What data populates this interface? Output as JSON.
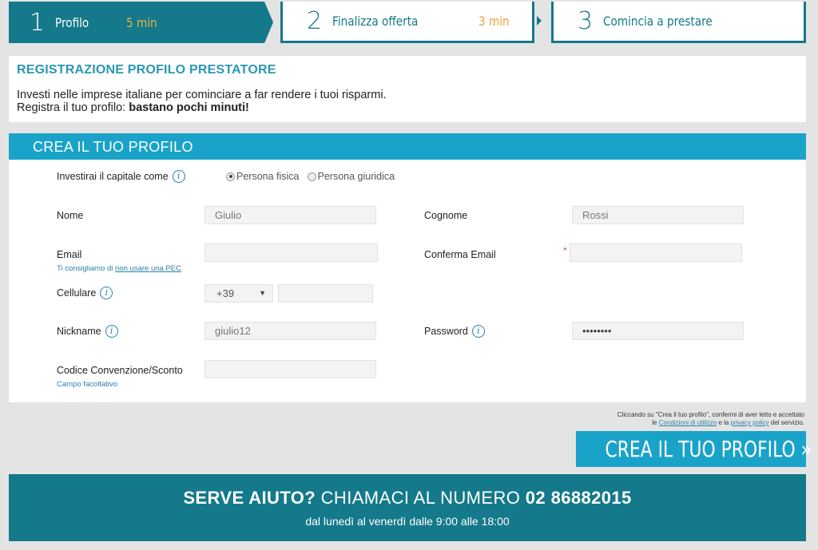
{
  "steps": [
    {
      "num": "1",
      "label": "Profilo",
      "time": "5 min"
    },
    {
      "num": "2",
      "label": "Finalizza offerta",
      "time": "3 min"
    },
    {
      "num": "3",
      "label": "Comincia a prestare",
      "time": ""
    }
  ],
  "intro": {
    "title": "REGISTRAZIONE PROFILO PRESTATORE",
    "line1": "Investi nelle imprese italiane per cominciare a far rendere i tuoi risparmi.",
    "line2_prefix": "Registra il tuo profilo: ",
    "line2_bold": "bastano pochi minuti!"
  },
  "form": {
    "header": "CREA IL TUO PROFILO",
    "invest_label": "Investirai il capitale come",
    "radio_options": [
      {
        "label": "Persona fisica",
        "checked": true
      },
      {
        "label": "Persona giuridica",
        "checked": false
      }
    ],
    "nome": {
      "label": "Nome",
      "value": "Giulio"
    },
    "cognome": {
      "label": "Cognome",
      "value": "Rossi"
    },
    "email": {
      "label": "Email",
      "value": "",
      "hint_prefix": "Ti consigliamo di ",
      "hint_link": "non usare una PEC"
    },
    "conferma_email": {
      "label": "Conferma Email",
      "value": "",
      "required_mark": "*"
    },
    "cellulare": {
      "label": "Cellulare",
      "prefix": "+39",
      "value": ""
    },
    "nickname": {
      "label": "Nickname",
      "value": "giulio12"
    },
    "password": {
      "label": "Password",
      "value": "••••••••"
    },
    "codice": {
      "label": "Codice Convenzione/Sconto",
      "value": "",
      "hint": "Campo facoltativo"
    }
  },
  "terms": {
    "line1": "Cliccando su \"Crea il tuo profilo\", confermi di aver letto e accettato",
    "line2_prefix": "le ",
    "link1": "Condizioni di utilizzo",
    "line2_mid": " e la ",
    "link2": "privacy policy",
    "line2_suffix": " del servizio."
  },
  "cta_label": "CREA IL TUO PROFILO »",
  "help": {
    "bold1": "SERVE AIUTO?",
    "mid": " CHIAMACI AL NUMERO ",
    "phone": "02 86882015",
    "hours": "dal lunedì al venerdì dalle 9:00 alle 18:00"
  },
  "colors": {
    "teal_dark": "#14798a",
    "teal_light": "#1aa3c9",
    "accent_orange": "#e8a33c",
    "info_blue": "#2a7fa8"
  },
  "icons": {
    "info": "info-icon",
    "caret": "chevron-down-icon"
  }
}
